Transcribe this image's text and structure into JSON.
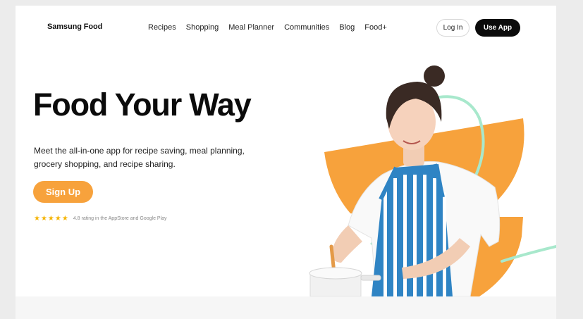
{
  "brand": {
    "name": "Samsung Food"
  },
  "nav": {
    "items": [
      "Recipes",
      "Shopping",
      "Meal Planner",
      "Communities",
      "Blog",
      "Food+"
    ]
  },
  "header": {
    "login_label": "Log In",
    "use_app_label": "Use App"
  },
  "hero": {
    "headline": "Food Your Way",
    "description": "Meet the all-in-one app for recipe saving, meal planning, grocery shopping, and recipe sharing.",
    "signup_label": "Sign Up",
    "stars": "★★★★★",
    "rating_text": "4.8 rating in the AppStore and Google Play",
    "rating_value": 4.8
  },
  "colors": {
    "accent_orange": "#f7a23c",
    "mint_line": "#a8e8cc",
    "primary_dark": "#0b0b0b"
  },
  "icons": {
    "rating": "star-icon"
  }
}
